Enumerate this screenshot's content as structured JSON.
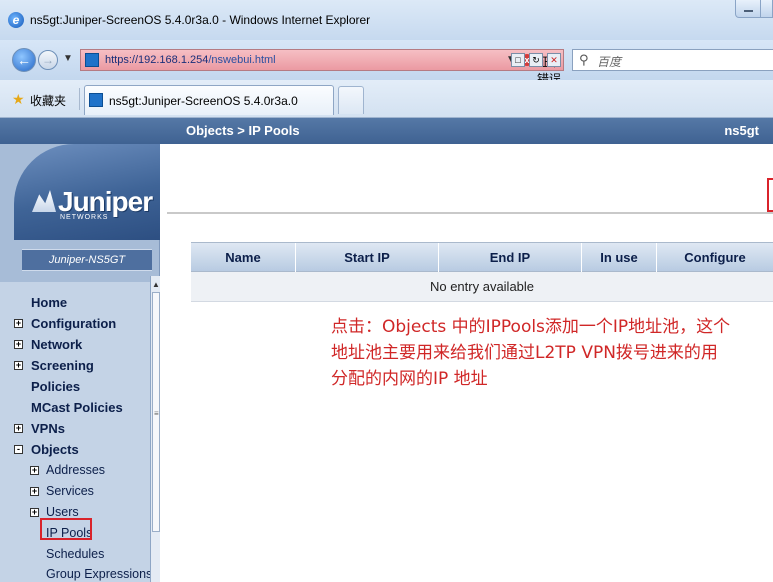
{
  "window": {
    "title": "ns5gt:Juniper-ScreenOS 5.4.0r3a.0 - Windows Internet Explorer"
  },
  "address_bar": {
    "url_scheme_host": "https://192.168.1.254",
    "url_path": "/nswebui.html",
    "cert_error_label": "证书错误",
    "search_placeholder": "百度"
  },
  "favorites": {
    "label": "收藏夹"
  },
  "tab": {
    "label": "ns5gt:Juniper-ScreenOS 5.4.0r3a.0"
  },
  "header": {
    "breadcrumb": "Objects > IP Pools",
    "device": "ns5gt"
  },
  "sidebar": {
    "logo": "Juniper",
    "logo_sub": "NETWORKS",
    "model": "Juniper-NS5GT",
    "items": [
      {
        "label": "Home",
        "expander": ""
      },
      {
        "label": "Configuration",
        "expander": "+"
      },
      {
        "label": "Network",
        "expander": "+"
      },
      {
        "label": "Screening",
        "expander": "+"
      },
      {
        "label": "Policies",
        "expander": ""
      },
      {
        "label": "MCast Policies",
        "expander": ""
      },
      {
        "label": "VPNs",
        "expander": "+"
      },
      {
        "label": "Objects",
        "expander": "-"
      }
    ],
    "sub_items": [
      {
        "label": "Addresses",
        "expander": "+"
      },
      {
        "label": "Services",
        "expander": "+"
      },
      {
        "label": "Users",
        "expander": "+"
      },
      {
        "label": "IP Pools",
        "expander": ""
      },
      {
        "label": "Schedules",
        "expander": ""
      },
      {
        "label": "Group Expressions",
        "expander": ""
      }
    ],
    "selected": "IP Pools"
  },
  "table": {
    "columns": [
      "Name",
      "Start IP",
      "End IP",
      "In use",
      "Configure"
    ],
    "empty_message": "No entry available"
  },
  "annotation": {
    "line1": "点击：Objects 中的IPPools添加一个IP地址池，这个",
    "line2": "地址池主要用来给我们通过L2TP VPN拨号进来的用",
    "line3": "分配的内网的IP 地址"
  },
  "colors": {
    "header_bg": "#3f6292",
    "sidebar_bg": "#c4d3e6",
    "highlight_red": "#d9232b",
    "annotation_red": "#d02727"
  }
}
